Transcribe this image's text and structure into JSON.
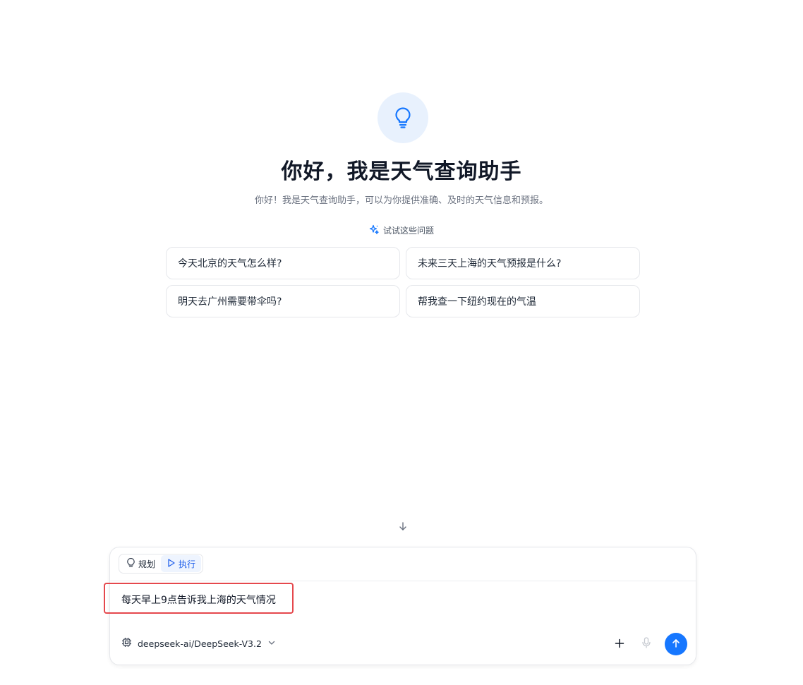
{
  "hero": {
    "icon": "lightbulb-icon",
    "title": "你好，我是天气查询助手",
    "subtitle": "你好！我是天气查询助手，可以为你提供准确、及时的天气信息和预报。"
  },
  "suggestions": {
    "label": "试试这些问题",
    "icon": "sparkle-icon",
    "items": [
      "今天北京的天气怎么样?",
      "未来三天上海的天气预报是什么?",
      "明天去广州需要带伞吗?",
      "帮我查一下纽约现在的气温"
    ]
  },
  "composer": {
    "modes": {
      "plan": "规划",
      "execute": "执行",
      "active": "execute"
    },
    "input_value": "每天早上9点告诉我上海的天气情况",
    "model": "deepseek-ai/DeepSeek-V3.2"
  },
  "colors": {
    "accent": "#1677ff",
    "active_mode": "#2563eb",
    "highlight": "#e5484d"
  }
}
